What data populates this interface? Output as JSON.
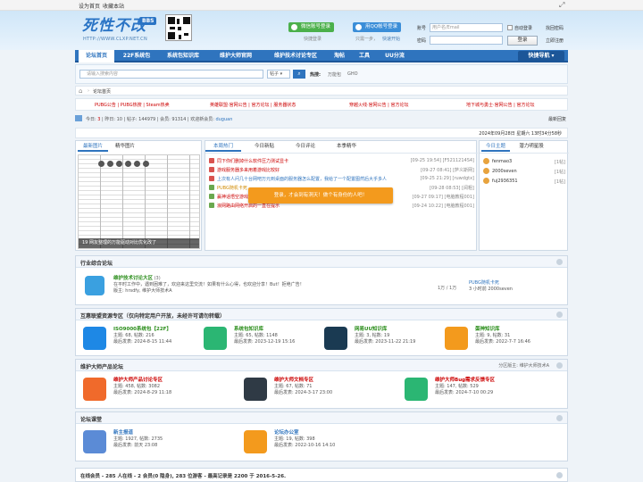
{
  "topbar": {
    "set_home": "设为首页",
    "bookmark": "收藏本站"
  },
  "logo": {
    "text": "死性不改",
    "badge": "BBS",
    "url": "HTTP://WWW.CLXP.NET.CN"
  },
  "social": {
    "wechat": "微信账号登录",
    "wechat_sub": "快捷登录",
    "qq": "用QQ帐号登录",
    "qq_sub1": "只需一步，",
    "qq_sub2": "快速开始"
  },
  "login": {
    "account_label": "账号",
    "account_placeholder": "用户名/Email",
    "auto_login": "自动登录",
    "forgot": "找回密码",
    "password_label": "密码",
    "login_btn": "登录",
    "register": "立即注册"
  },
  "nav": {
    "items": [
      "论坛首页",
      "22F系统包",
      "系统包知识库",
      "维护大师官网",
      "维护技术讨论专区",
      "淘帖",
      "工具",
      "UU分流"
    ],
    "quick": "快捷导航"
  },
  "search": {
    "placeholder": "请输入搜索内容",
    "scope": "帖子",
    "hot_label": "热搜:",
    "hot": [
      "万能包",
      "GHO"
    ]
  },
  "breadcrumb": {
    "home": "⌂",
    "sep": "›",
    "current": "论坛首页"
  },
  "ads": [
    "PUBG公告 | PUBG热搜 | Steam热卖",
    "英雄联盟·官网公告 | 官方论坛 | 服务器状态",
    "穿越火线·官网公告 | 官方论坛",
    "地下城与勇士·官网公告 | 官方论坛"
  ],
  "stats": {
    "today_label": "今日:",
    "today": "3",
    "yesterday_label": "昨日:",
    "yesterday": "10",
    "posts_label": "帖子:",
    "posts": "144979",
    "members_label": "会员:",
    "members": "91314",
    "welcome_label": "欢迎新会员:",
    "newest": "duguan",
    "newest_reply": "最新回复"
  },
  "date": "2024年09月28日 星期六 13时34分58秒",
  "left_tabs": [
    "最新图片",
    "精华图片"
  ],
  "slide_caption": "19 网友整理的万能驱动对比优化改了",
  "hot_tabs": [
    "本周热门",
    "今日新贴",
    "今日评论",
    "本季精华"
  ],
  "hot_list": [
    {
      "title": "同下你们删掉什么软件压力测试显卡",
      "meta": "[09-25 19:54] [F5211214S4]",
      "color": "#c00"
    },
    {
      "title": "游戏服务器多来用着游戏比较好",
      "meta": "[09-27 08:41] [萨义斯网]",
      "color": "#c00"
    },
    {
      "title": "上次有人问几十台网吧万元到桌面的服务器怎么配置，我给了一个配置图然后大乎多人",
      "meta": "[09-25 21:29] [ruwdgtx]",
      "color": "#2f74be"
    },
    {
      "title": "PUBG随机卡死",
      "meta": "[09-28 08:53] [阅粗]",
      "color": "#d08a00"
    },
    {
      "title": "赢神话悟空游戏卡顿有什么解决",
      "meta": "[09-27 09:17] [电脑教程001]",
      "color": "#c00"
    },
    {
      "title": "浪网路由网络开启的一直在提示",
      "meta": "[09-24 10:22] [电脑教程001]",
      "color": "#c00"
    }
  ],
  "toast": "登录，才会到有洞天！做个有身份的人吧！",
  "star_tabs": [
    "今日主题",
    "潜力明星股"
  ],
  "stars": [
    {
      "name": "fenmao3",
      "count": "[1帖]"
    },
    {
      "name": "2000seven",
      "count": "[1帖]"
    },
    {
      "name": "fuj2936351",
      "count": "[1帖]"
    }
  ],
  "section1": {
    "title": "行业综合论坛",
    "forum": "维护技术讨论大区",
    "forum_count": "(3)",
    "desc": "在平时工作中，遇到困难了，欢迎来这里交流！如果有什么心得，也欢迎分享！But！拒绝广告！",
    "mods": "版主: hrsdfy, 维护大师技术A",
    "stat": "1万 / 1万",
    "last_title": "PUBG随机卡死",
    "last_time": "3 小时前 2000seven"
  },
  "section2": {
    "title": "互惠联盟资源专区（仅向特定用户开放，未经许可请勿转载）",
    "forums": [
      {
        "name": "ISO9000系统包【22F】",
        "stats": "主题: 68, 帖数: 216",
        "last": "最后发表: 2024-8-15 11:44"
      },
      {
        "name": "系统包知识库",
        "stats": "主题: 65, 帖数: 1148",
        "last": "最后发表: 2023-12-19 15:16"
      },
      {
        "name": "网易UU知识库",
        "stats": "主题: 3, 帖数: 19",
        "last": "最后发表: 2023-11-22 21:19"
      },
      {
        "name": "蛋神知识库",
        "stats": "主题: 9, 帖数: 31",
        "last": "最后发表: 2022-7-7 16:46"
      }
    ]
  },
  "section3": {
    "title": "维护大师产品论坛",
    "mods": "分区版主: 维护大师技术A",
    "forums": [
      {
        "name": "维护大师产品讨论专区",
        "stats": "主题: 458, 帖数: 3082",
        "last": "最后发表: 2024-8-29 11:18"
      },
      {
        "name": "维护大师文档专区",
        "stats": "主题: 67, 帖数: 71",
        "last": "最后发表: 2024-3-17 23:00"
      },
      {
        "name": "维护大师Bug需求反馈专区",
        "stats": "主题: 147, 帖数: 529",
        "last": "最后发表: 2024-7-10 00:29"
      }
    ]
  },
  "section4": {
    "title": "论坛课堂",
    "forums": [
      {
        "name": "新主报道",
        "stats": "主题: 1927, 帖数: 2735",
        "last": "最后发表: 前天 23:08"
      },
      {
        "name": "论坛办公室",
        "stats": "主题: 19, 帖数: 398",
        "last": "最后发表: 2022-10-16 14:10"
      }
    ]
  },
  "online": "在线会员 - 285 人在线 - 2 会员(0 隐身), 283 位游客 - 最高记录是 2200 于 2016-5-26."
}
